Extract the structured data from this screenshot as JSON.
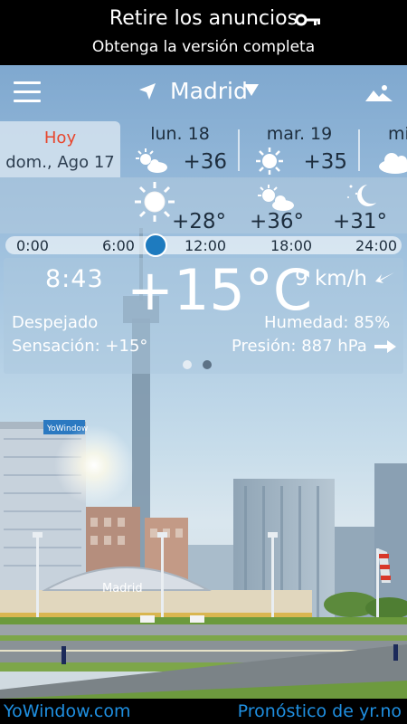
{
  "ad": {
    "line1": "Retire los anuncios",
    "line2": "Obtenga la versión completa",
    "icon": "key-icon"
  },
  "nav": {
    "city": "Madrid"
  },
  "days": {
    "today": {
      "name": "Hoy",
      "date": "dom., Ago 17"
    },
    "items": [
      {
        "name": "lun. 18",
        "temp": "+36",
        "icon": "sun-cloud-icon"
      },
      {
        "name": "mar. 19",
        "temp": "+35",
        "icon": "sun-icon"
      },
      {
        "name": "mi",
        "temp": "",
        "icon": "cloud-icon"
      }
    ]
  },
  "hourly": {
    "temps": [
      "+28°",
      "+36°",
      "+31°"
    ],
    "icons": [
      "sun-icon",
      "sun-cloud-icon",
      "moon-stars-icon"
    ],
    "times": [
      "0:00",
      "6:00",
      "12:00",
      "18:00",
      "24:00"
    ],
    "current_fraction": 0.29
  },
  "current": {
    "time": "8:43",
    "temp": "+15°C",
    "wind": "9 km/h",
    "condition": "Despejado",
    "feels_like": "Sensación: +15°",
    "humidity": "Humedad: 85%",
    "pressure": "Presión: 887 hPa",
    "page": 1,
    "pages": 2
  },
  "scene": {
    "stadium_sign": "Madrid",
    "billboard": "YoWindow"
  },
  "footer": {
    "left": "YoWindow.com",
    "right": "Pronóstico de yr.no"
  },
  "colors": {
    "today": "#e8452c",
    "accent": "#1e7bbf",
    "footer_link": "#1f8fe0"
  }
}
